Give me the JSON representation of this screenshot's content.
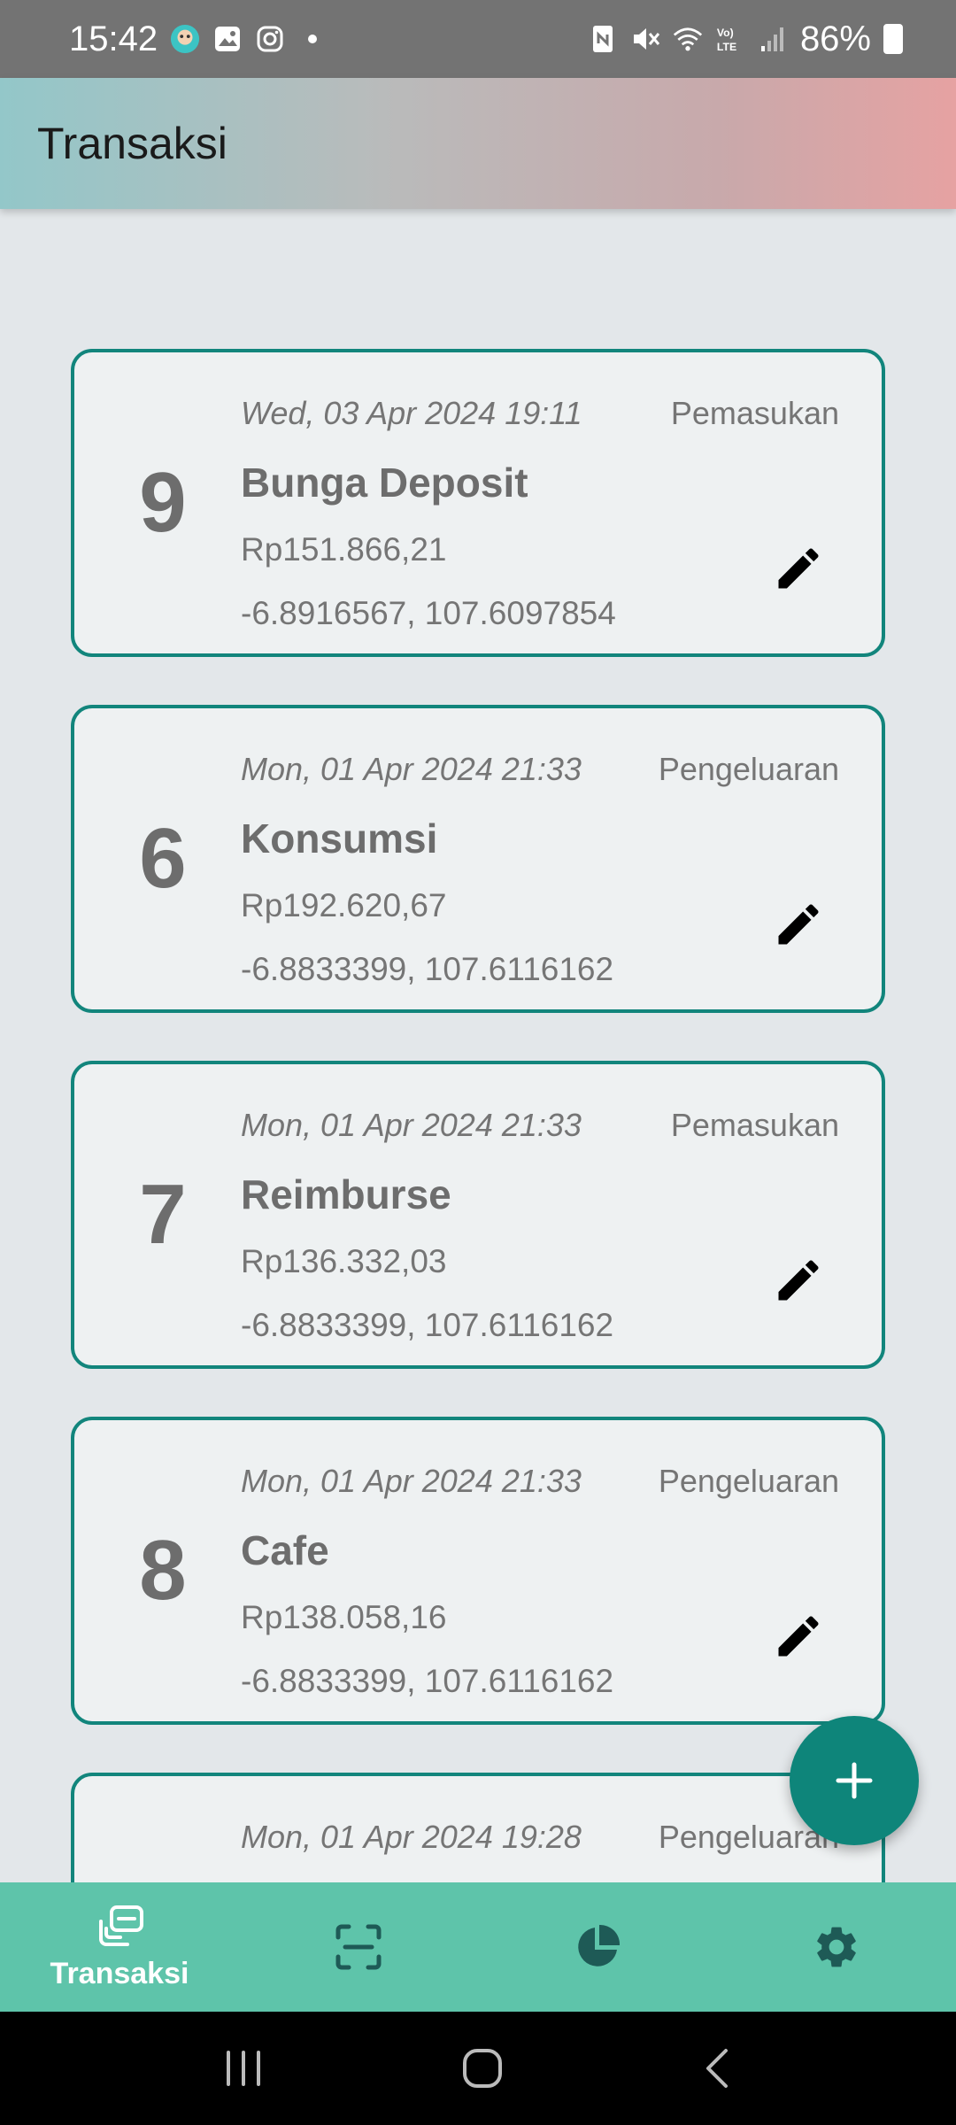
{
  "status_bar": {
    "time": "15:42",
    "battery_text": "86%",
    "left_icons": [
      "app-notification-icon",
      "gallery-icon",
      "instagram-icon",
      "dot-icon"
    ],
    "right_icons": [
      "nfc-icon",
      "mute-icon",
      "wifi-icon",
      "volte-icon",
      "signal-icon",
      "battery-icon"
    ]
  },
  "app_bar": {
    "title": "Transaksi"
  },
  "transactions": [
    {
      "number": "9",
      "date": "Wed, 03 Apr 2024 19:11",
      "type": "Pemasukan",
      "title": "Bunga Deposit",
      "amount": "Rp151.866,21",
      "coordinates": "-6.8916567, 107.6097854"
    },
    {
      "number": "6",
      "date": "Mon, 01 Apr 2024 21:33",
      "type": "Pengeluaran",
      "title": "Konsumsi",
      "amount": "Rp192.620,67",
      "coordinates": "-6.8833399, 107.6116162"
    },
    {
      "number": "7",
      "date": "Mon, 01 Apr 2024 21:33",
      "type": "Pemasukan",
      "title": "Reimburse",
      "amount": "Rp136.332,03",
      "coordinates": "-6.8833399, 107.6116162"
    },
    {
      "number": "8",
      "date": "Mon, 01 Apr 2024 21:33",
      "type": "Pengeluaran",
      "title": "Cafe",
      "amount": "Rp138.058,16",
      "coordinates": "-6.8833399, 107.6116162"
    },
    {
      "number": "",
      "date": "Mon, 01 Apr 2024 19:28",
      "type": "Pengeluaran",
      "title": "",
      "amount": "",
      "coordinates": ""
    }
  ],
  "fab": {
    "icon": "plus-icon"
  },
  "bottom_nav": {
    "items": [
      {
        "label": "Transaksi",
        "icon": "transactions-icon",
        "active": true
      },
      {
        "label": "",
        "icon": "scan-icon",
        "active": false
      },
      {
        "label": "",
        "icon": "pie-chart-icon",
        "active": false
      },
      {
        "label": "",
        "icon": "settings-icon",
        "active": false
      }
    ]
  },
  "system_nav": {
    "icons": [
      "recents-icon",
      "home-icon",
      "back-icon"
    ]
  },
  "colors": {
    "accent": "#12857c",
    "nav_background": "#5ec4aa",
    "fab": "#0e857a"
  }
}
